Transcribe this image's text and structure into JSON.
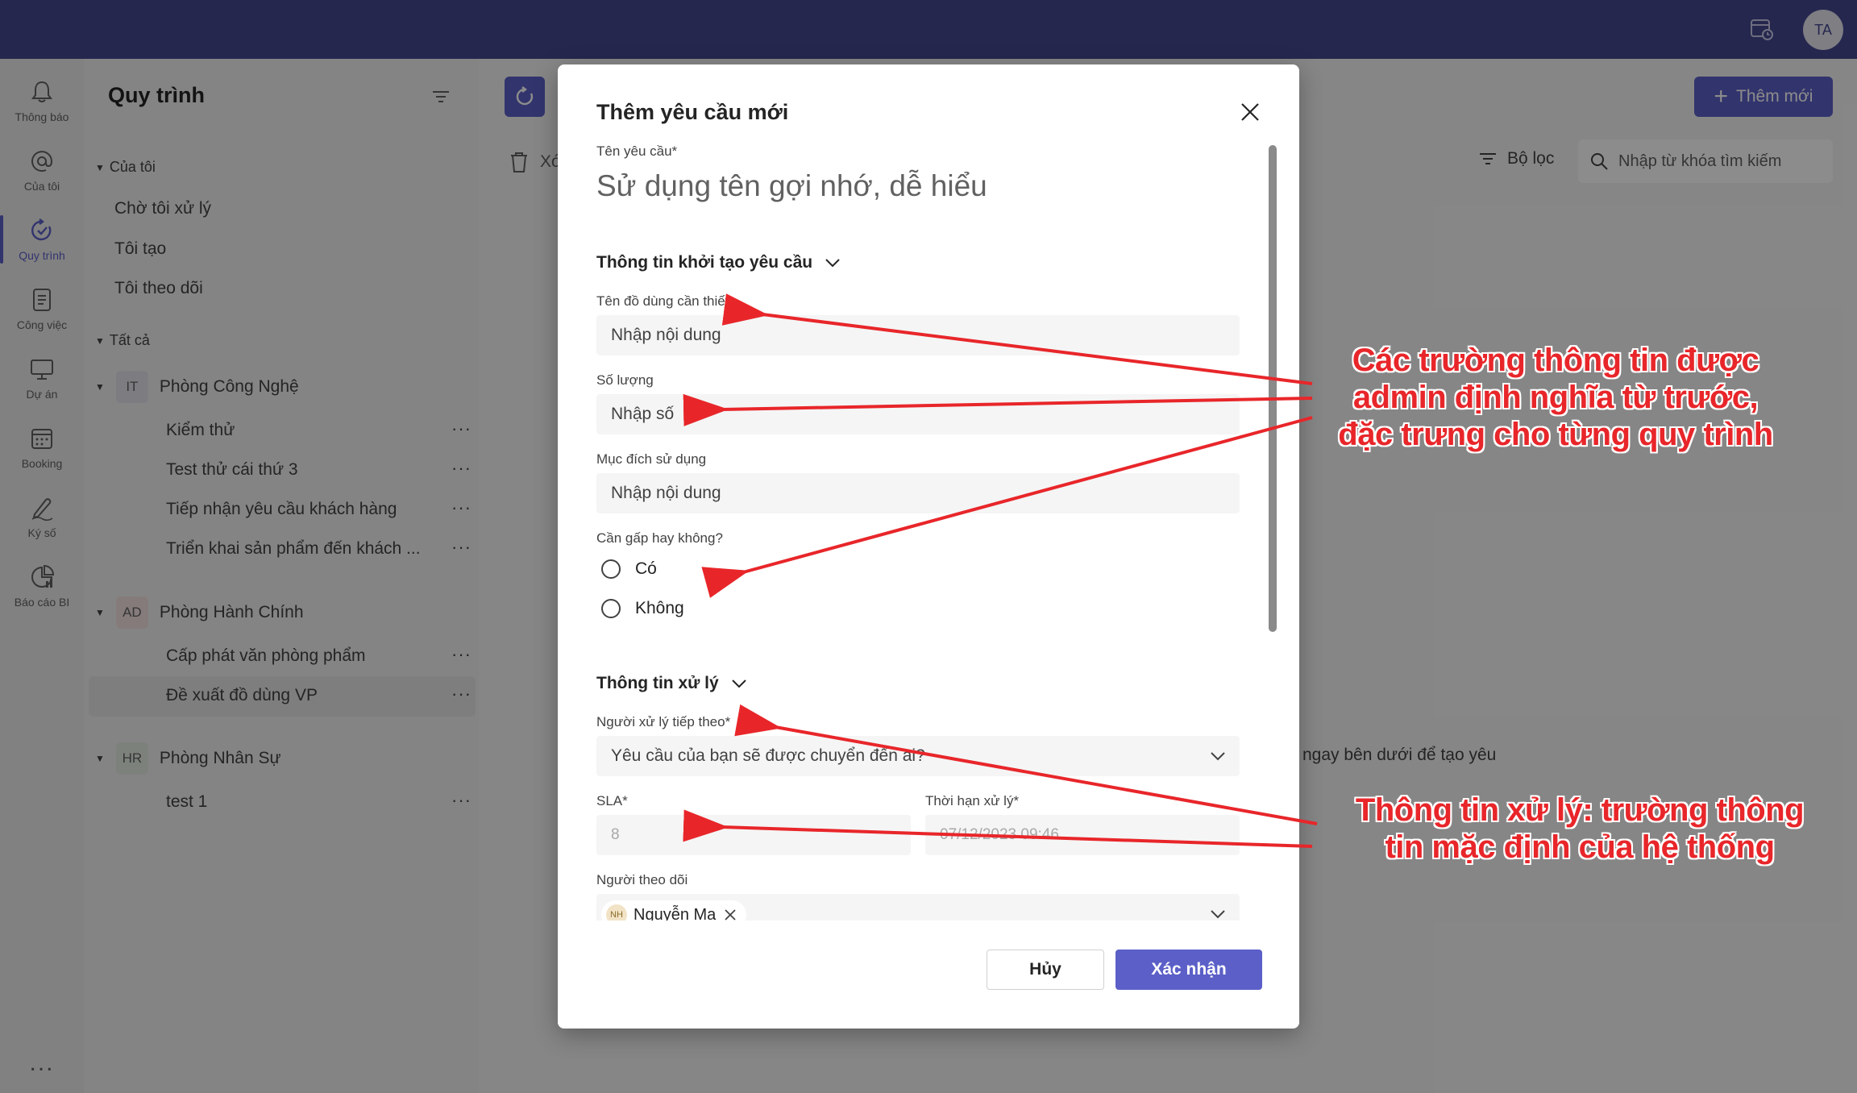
{
  "topbar": {
    "avatar_initials": "TA"
  },
  "rail": {
    "items": [
      {
        "label": "Thông báo",
        "icon": "bell-icon"
      },
      {
        "label": "Của tôi",
        "icon": "at-icon"
      },
      {
        "label": "Quy trình",
        "icon": "process-icon"
      },
      {
        "label": "Công việc",
        "icon": "tasks-icon"
      },
      {
        "label": "Dự án",
        "icon": "project-icon"
      },
      {
        "label": "Booking",
        "icon": "calendar-icon"
      },
      {
        "label": "Ký số",
        "icon": "sign-icon"
      },
      {
        "label": "Báo cáo BI",
        "icon": "report-icon"
      }
    ],
    "more": "..."
  },
  "panel": {
    "title": "Quy trình",
    "mine_section": "Của tôi",
    "mine_items": [
      "Chờ tôi xử lý",
      "Tôi tạo",
      "Tôi theo dõi"
    ],
    "all_section": "Tất cả",
    "groups": [
      {
        "badge": "IT",
        "name": "Phòng Công Nghệ",
        "items": [
          "Kiểm thử",
          "Test thử cái thứ 3",
          "Tiếp nhận yêu cầu khách hàng",
          "Triển khai sản phẩm đến khách ..."
        ]
      },
      {
        "badge": "AD",
        "name": "Phòng Hành Chính",
        "items": [
          "Cấp phát văn phòng phẩm",
          "Đề xuất đồ dùng VP"
        ]
      },
      {
        "badge": "HR",
        "name": "Phòng Nhân Sự",
        "items": [
          "test 1"
        ]
      }
    ],
    "more": "···"
  },
  "main": {
    "add_label": "Thêm mới",
    "delete_label": "Xó",
    "filter_label": "Bộ lọc",
    "search_placeholder": "Nhập từ khóa tìm kiếm",
    "hint": "ngay bên dưới để tạo yêu"
  },
  "dialog": {
    "title": "Thêm yêu cầu mới",
    "name_label": "Tên yêu cầu*",
    "name_placeholder": "Sử dụng tên gợi nhớ, dễ hiểu",
    "section1": "Thông tin khởi tạo yêu cầu",
    "f1_label": "Tên đồ dùng cần thiết",
    "f1_placeholder": "Nhập nội dung",
    "f2_label": "Số lượng",
    "f2_placeholder": "Nhập số",
    "f3_label": "Mục đích sử dụng",
    "f3_placeholder": "Nhập nội dung",
    "f4_label": "Cần gấp hay không?",
    "f4_options": [
      "Có",
      "Không"
    ],
    "section2": "Thông tin xử lý",
    "assignee_label": "Người xử lý tiếp theo*",
    "assignee_placeholder": "Yêu cầu của bạn sẽ được chuyển đến ai?",
    "sla_label": "SLA*",
    "sla_value": "8",
    "deadline_label": "Thời hạn xử lý*",
    "deadline_value": "07/12/2023 09:46",
    "followers_label": "Người theo dõi",
    "follower_initials": "NH",
    "follower_name": "Nguyễn Ma",
    "cancel": "Hủy",
    "confirm": "Xác nhận"
  },
  "annotations": {
    "custom_fields": [
      "Các trường thông tin được",
      "admin định nghĩa từ trước,",
      "đặc trưng cho từng quy trình"
    ],
    "default_fields": [
      "Thông tin xử lý: trường thông",
      "tin mặc định của hệ thống"
    ]
  },
  "colors": {
    "brand": "#5b5fc7",
    "topbar": "#444791",
    "annotation": "#e8262a"
  }
}
